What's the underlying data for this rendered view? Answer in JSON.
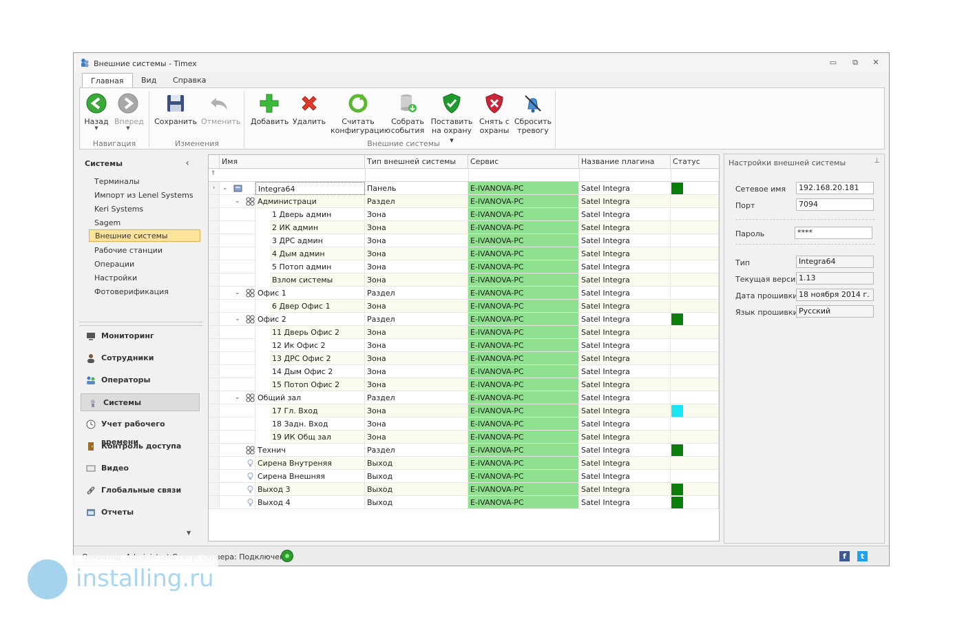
{
  "window": {
    "title": "Внешние системы - Timex"
  },
  "menu_tabs": [
    "Главная",
    "Вид",
    "Справка"
  ],
  "ribbon": {
    "groups": [
      "Навигация",
      "Изменения",
      "Внешние системы"
    ],
    "back": "Назад",
    "forward": "Вперед",
    "save": "Сохранить",
    "undo": "Отменить",
    "add": "Добавить",
    "delete": "Удалить",
    "read_config_1": "Считать",
    "read_config_2": "конфигурацию",
    "collect_1": "Собрать",
    "collect_2": "события",
    "arm_1": "Поставить",
    "arm_2": "на охрану",
    "disarm_1": "Снять с",
    "disarm_2": "охраны",
    "reset_1": "Сбросить",
    "reset_2": "тревогу"
  },
  "left_panel": {
    "header": "Системы",
    "items": [
      "Терминалы",
      "Импорт из Lenel Systems",
      "Keri Systems",
      "Sagem",
      "Внешние системы",
      "Рабочие станции",
      "Операции",
      "Настройки",
      "Фотоверификация"
    ],
    "nav": [
      "Мониторинг",
      "Сотрудники",
      "Операторы",
      "Системы",
      "Учет рабочего времени",
      "Контроль доступа",
      "Видео",
      "Глобальные связи",
      "Отчеты"
    ]
  },
  "grid": {
    "columns": [
      "Имя",
      "Тип внешней системы",
      "Сервис",
      "Название плагина",
      "Статус"
    ],
    "rows": [
      {
        "name": "Integra64",
        "type": "Панель",
        "service": "E-IVANOVA-PC",
        "plugin": "Satel Integra",
        "status": "#0a7d0a"
      },
      {
        "name": "Администраци",
        "type": "Раздел",
        "service": "E-IVANOVA-PC",
        "plugin": "Satel Integra",
        "status": ""
      },
      {
        "name": "1 Дверь админ",
        "type": "Зона",
        "service": "E-IVANOVA-PC",
        "plugin": "Satel Integra",
        "status": ""
      },
      {
        "name": "2 ИК админ",
        "type": "Зона",
        "service": "E-IVANOVA-PC",
        "plugin": "Satel Integra",
        "status": ""
      },
      {
        "name": "3 ДРС админ",
        "type": "Зона",
        "service": "E-IVANOVA-PC",
        "plugin": "Satel Integra",
        "status": ""
      },
      {
        "name": "4 Дым админ",
        "type": "Зона",
        "service": "E-IVANOVA-PC",
        "plugin": "Satel Integra",
        "status": ""
      },
      {
        "name": "5 Потоп админ",
        "type": "Зона",
        "service": "E-IVANOVA-PC",
        "plugin": "Satel Integra",
        "status": ""
      },
      {
        "name": "Взлом системы",
        "type": "Зона",
        "service": "E-IVANOVA-PC",
        "plugin": "Satel Integra",
        "status": ""
      },
      {
        "name": "Офис 1",
        "type": "Раздел",
        "service": "E-IVANOVA-PC",
        "plugin": "Satel Integra",
        "status": ""
      },
      {
        "name": "6 Двер Офис 1",
        "type": "Зона",
        "service": "E-IVANOVA-PC",
        "plugin": "Satel Integra",
        "status": ""
      },
      {
        "name": "Офис 2",
        "type": "Раздел",
        "service": "E-IVANOVA-PC",
        "plugin": "Satel Integra",
        "status": "#0a7d0a"
      },
      {
        "name": "11 Дверь Офис 2",
        "type": "Зона",
        "service": "E-IVANOVA-PC",
        "plugin": "Satel Integra",
        "status": ""
      },
      {
        "name": "12 Ик Офис 2",
        "type": "Зона",
        "service": "E-IVANOVA-PC",
        "plugin": "Satel Integra",
        "status": ""
      },
      {
        "name": "13 ДРС Офис 2",
        "type": "Зона",
        "service": "E-IVANOVA-PC",
        "plugin": "Satel Integra",
        "status": ""
      },
      {
        "name": "14 Дым Офис 2",
        "type": "Зона",
        "service": "E-IVANOVA-PC",
        "plugin": "Satel Integra",
        "status": ""
      },
      {
        "name": "15 Потоп Офис 2",
        "type": "Зона",
        "service": "E-IVANOVA-PC",
        "plugin": "Satel Integra",
        "status": ""
      },
      {
        "name": "Общий зал",
        "type": "Раздел",
        "service": "E-IVANOVA-PC",
        "plugin": "Satel Integra",
        "status": ""
      },
      {
        "name": "17 Гл. Вход",
        "type": "Зона",
        "service": "E-IVANOVA-PC",
        "plugin": "Satel Integra",
        "status": "#19e6f2"
      },
      {
        "name": "18 Задн. Вход",
        "type": "Зона",
        "service": "E-IVANOVA-PC",
        "plugin": "Satel Integra",
        "status": ""
      },
      {
        "name": "19 ИК Общ зал",
        "type": "Зона",
        "service": "E-IVANOVA-PC",
        "plugin": "Satel Integra",
        "status": ""
      },
      {
        "name": "Технич",
        "type": "Раздел",
        "service": "E-IVANOVA-PC",
        "plugin": "Satel Integra",
        "status": "#0a7d0a"
      },
      {
        "name": "Сирена Внутреняя",
        "type": "Выход",
        "service": "E-IVANOVA-PC",
        "plugin": "Satel Integra",
        "status": ""
      },
      {
        "name": "Сирена Внешняя",
        "type": "Выход",
        "service": "E-IVANOVA-PC",
        "plugin": "Satel Integra",
        "status": ""
      },
      {
        "name": "Выход   3",
        "type": "Выход",
        "service": "E-IVANOVA-PC",
        "plugin": "Satel Integra",
        "status": "#0a7d0a"
      },
      {
        "name": "Выход   4",
        "type": "Выход",
        "service": "E-IVANOVA-PC",
        "plugin": "Satel Integra",
        "status": "#0a7d0a"
      }
    ]
  },
  "settings": {
    "title": "Настройки внешней системы",
    "network_name_label": "Сетевое имя",
    "network_name": "192.168.20.181",
    "port_label": "Порт",
    "port": "7094",
    "password_label": "Пароль",
    "password": "****",
    "type_label": "Тип",
    "type": "Integra64",
    "version_label": "Текущая версия",
    "version": "1.13",
    "fw_date_label": "Дата прошивки",
    "fw_date": "18 ноября 2014 г.",
    "fw_lang_label": "Язык прошивки",
    "fw_lang": "Русский"
  },
  "status_bar": {
    "operator": "Оператор: Administrator",
    "server": "Статус сервера: Подключено"
  },
  "watermark": "installing.ru",
  "colors": {
    "service_bg": "#8fe08f",
    "selected_item": "#fde49c",
    "status_ok": "#0a7d0a",
    "status_cyan": "#19e6f2"
  }
}
